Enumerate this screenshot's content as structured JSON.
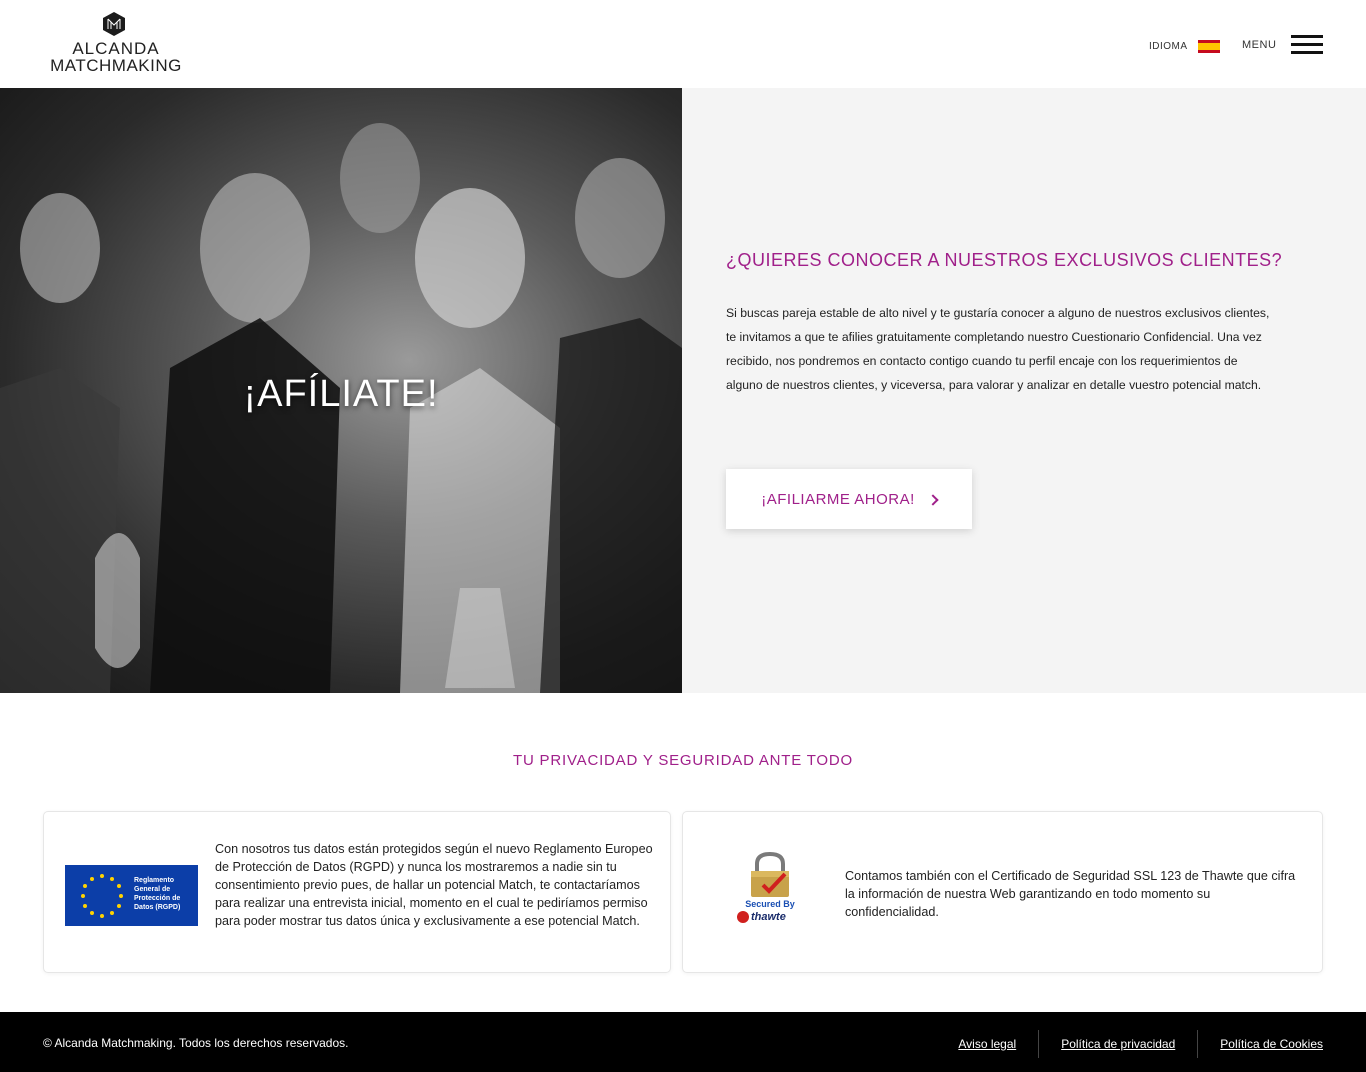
{
  "header": {
    "logo_line1": "ALCANDA",
    "logo_line2": "MATCHMAKING",
    "language_label": "IDIOMA",
    "menu_label": "MENU"
  },
  "hero": {
    "image_title": "¡AFÍLIATE!",
    "heading": "¿QUIERES CONOCER A NUESTROS EXCLUSIVOS CLIENTES?",
    "text": "Si buscas pareja estable de alto nivel y te gustaría conocer a alguno de nuestros exclusivos clientes, te invitamos a que te afilies gratuitamente completando nuestro Cuestionario Confidencial. Una vez recibido, nos pondremos en contacto contigo cuando tu perfil encaje con los requerimientos de alguno de nuestros clientes, y viceversa, para valorar y analizar en detalle vuestro potencial match.",
    "cta_label": "¡AFILIARME AHORA!"
  },
  "privacy": {
    "title": "TU PRIVACIDAD Y SEGURIDAD ANTE TODO",
    "card1_badge": "Reglamento General de Protección de Datos (RGPD)",
    "card1_text": "Con nosotros tus datos están protegidos según el nuevo Reglamento Europeo de Protección de Datos (RGPD) y nunca los mostraremos a nadie sin tu consentimiento previo pues, de hallar un potencial Match, te contactaríamos para realizar una entrevista inicial, momento en el cual te pediríamos permiso para poder mostrar tus datos única y exclusivamente a ese potencial Match.",
    "card2_secured": "Secured By",
    "card2_brand": "thawte",
    "card2_text": "Contamos también con el Certificado de Seguridad SSL 123 de Thawte que cifra la información de nuestra Web garantizando en todo momento su confidencialidad."
  },
  "footer": {
    "copyright": "© Alcanda Matchmaking. Todos los derechos reservados.",
    "links": [
      "Aviso legal",
      "Política de privacidad",
      "Política de Cookies"
    ]
  },
  "colors": {
    "accent": "#a0208a",
    "panel_bg": "#f4f4f4",
    "footer_bg": "#000000"
  }
}
